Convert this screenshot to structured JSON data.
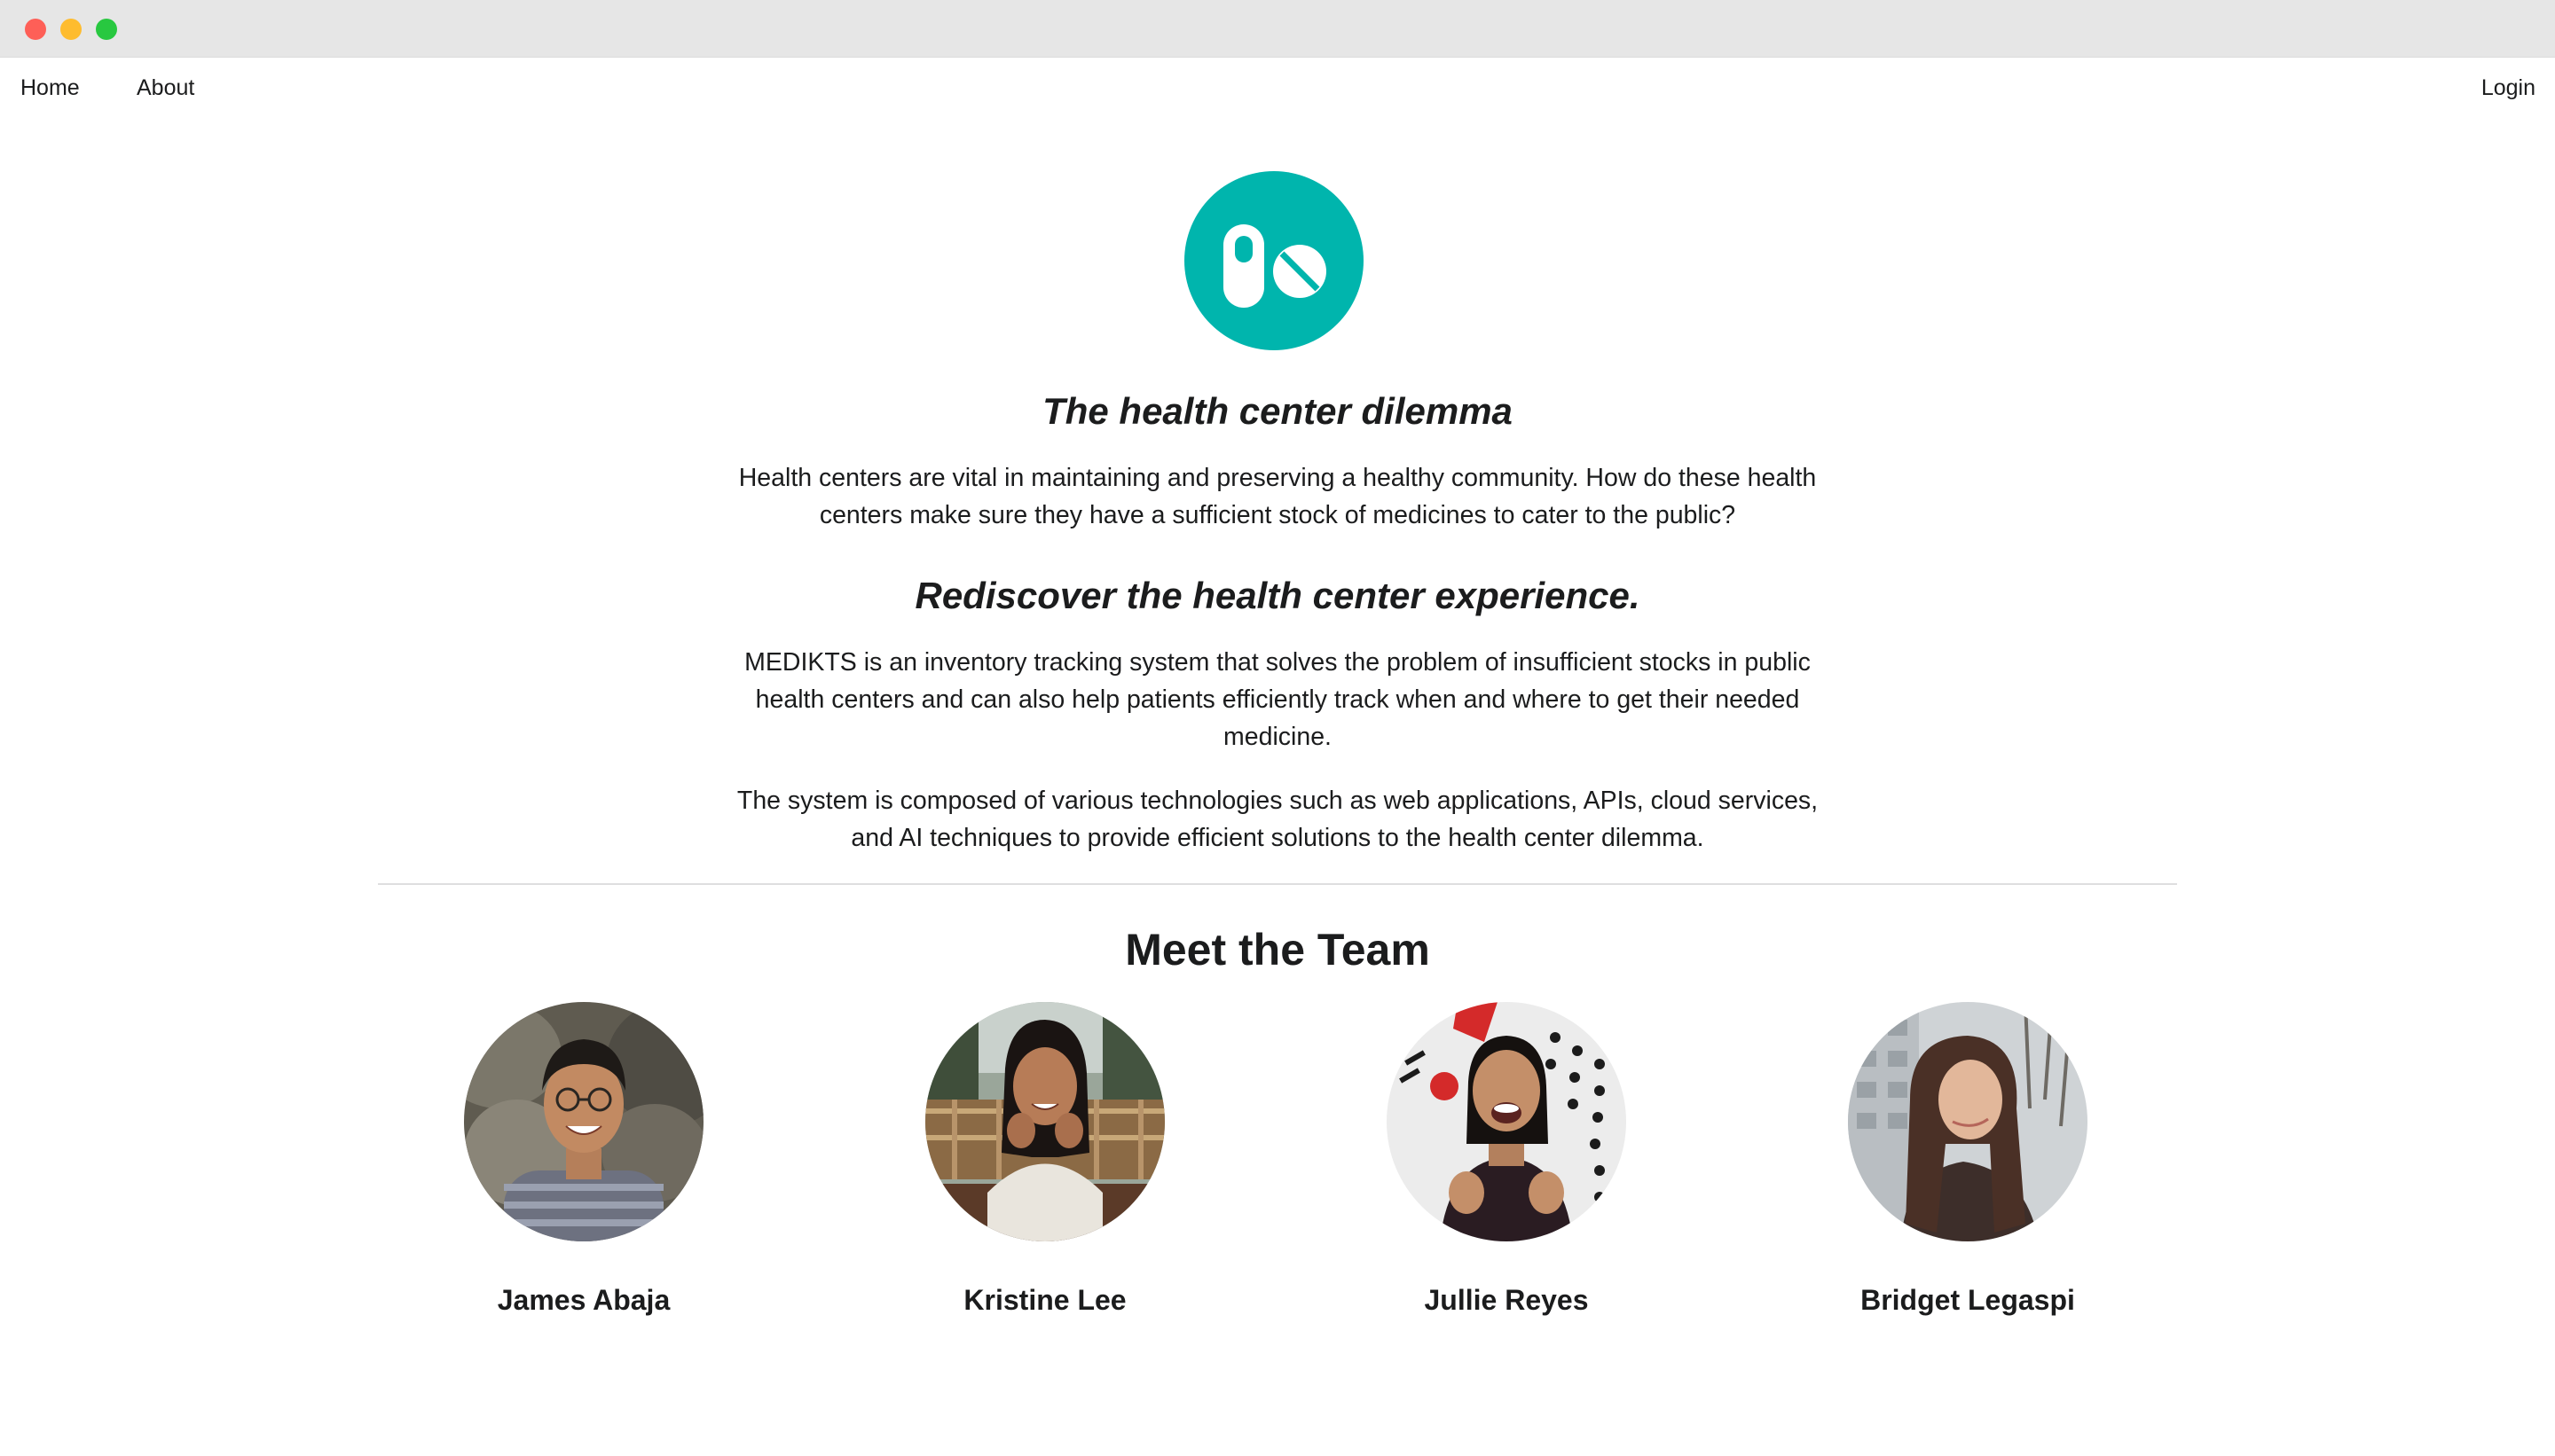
{
  "nav": {
    "home_label": "Home",
    "about_label": "About",
    "login_label": "Login"
  },
  "logo": {
    "icon": "pills-icon",
    "color": "#00b5ad"
  },
  "dilemma": {
    "heading": "The health center dilemma",
    "body": "Health centers are vital in maintaining and preserving a healthy community. How do these health centers make sure they have a sufficient stock of medicines to cater to the public?"
  },
  "rediscover": {
    "heading": "Rediscover the health center experience.",
    "body1": "MEDIKTS is an inventory tracking system that solves the problem of insufficient stocks in public health centers and can also help patients efficiently track when and where to get their needed medicine.",
    "body2": "The system is composed of various technologies such as web applications, APIs, cloud services, and AI techniques to provide efficient solutions to the health center dilemma."
  },
  "team": {
    "title": "Meet the Team",
    "members": [
      {
        "name": "James Abaja"
      },
      {
        "name": "Kristine Lee"
      },
      {
        "name": "Jullie Reyes"
      },
      {
        "name": "Bridget Legaspi"
      }
    ]
  }
}
